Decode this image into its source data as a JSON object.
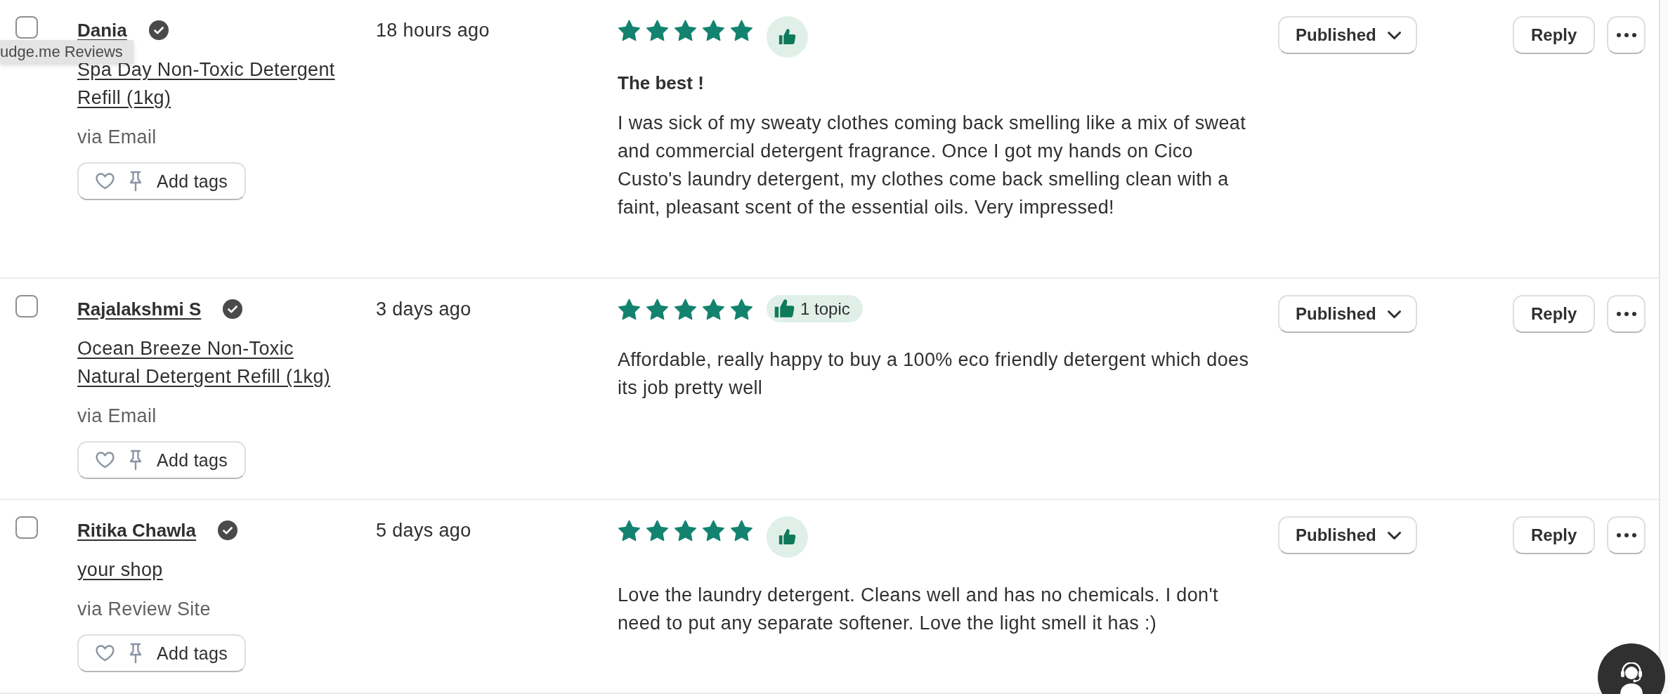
{
  "tooltip": {
    "text": "udge.me Reviews"
  },
  "reviews": [
    {
      "selected": false,
      "reviewer": "Dania",
      "verified": true,
      "product": "Spa Day Non-Toxic Detergent Refill (1kg)",
      "source": "via Email",
      "tags_button": "Add tags",
      "time": "18 hours ago",
      "stars": 5,
      "badge": {
        "kind": "icon"
      },
      "title": "The best !",
      "text": "I was sick of my sweaty clothes coming back smelling like a mix of sweat and commercial detergent fragrance. Once I got my hands on Cico Custo's laundry detergent, my clothes come back smelling clean with a faint, pleasant scent of the essential oils. Very impressed!",
      "status": "Published",
      "reply_button": "Reply"
    },
    {
      "selected": false,
      "reviewer": "Rajalakshmi S",
      "verified": true,
      "product": "Ocean Breeze Non-Toxic Natural Detergent Refill (1kg)",
      "source": "via Email",
      "tags_button": "Add tags",
      "time": "3 days ago",
      "stars": 5,
      "badge": {
        "kind": "topics",
        "label": "1 topic"
      },
      "text": "Affordable, really happy to buy a 100% eco friendly detergent which does its job pretty well",
      "status": "Published",
      "reply_button": "Reply"
    },
    {
      "selected": false,
      "reviewer": "Ritika Chawla",
      "verified": true,
      "product": "your shop",
      "source": "via Review Site",
      "tags_button": "Add tags",
      "time": "5 days ago",
      "stars": 5,
      "badge": {
        "kind": "icon"
      },
      "text": "Love the laundry detergent. Cleans well and has no chemicals. I don't need to put any separate softener. Love the light smell it has :)",
      "status": "Published",
      "reply_button": "Reply"
    }
  ]
}
